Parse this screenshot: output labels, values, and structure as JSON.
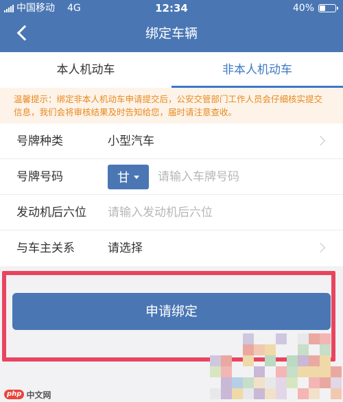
{
  "status_bar": {
    "carrier": "中国移动",
    "network": "4G",
    "time": "12:34",
    "battery": "40%",
    "battery_level": 0.4
  },
  "header": {
    "title": "绑定车辆",
    "back_icon": "chevron-left-icon"
  },
  "tabs": [
    {
      "label": "本人机动车",
      "active": false
    },
    {
      "label": "非本人机动车",
      "active": true
    }
  ],
  "notice": {
    "text": "温馨提示：绑定非本人机动车申请提交后，公安交管部门工作人员会仔细核实提交信息，我们会将审核结果及时告知给您，届时请注意查收。"
  },
  "form": {
    "plate_type": {
      "label": "号牌种类",
      "value": "小型汽车"
    },
    "plate_number": {
      "label": "号牌号码",
      "province": "甘",
      "placeholder": "请输入车牌号码"
    },
    "engine": {
      "label": "发动机后六位",
      "placeholder": "请输入发动机后六位"
    },
    "relation": {
      "label": "与车主关系",
      "placeholder": "请选择"
    }
  },
  "actions": {
    "apply_label": "申请绑定"
  },
  "watermark": {
    "logo": "php",
    "text": "中文网"
  },
  "colors": {
    "primary": "#4a77b4",
    "tab_active": "#3d78c4",
    "notice_text": "#e8891f",
    "notice_bg": "#fdf3e8",
    "highlight": "#e9445f"
  }
}
